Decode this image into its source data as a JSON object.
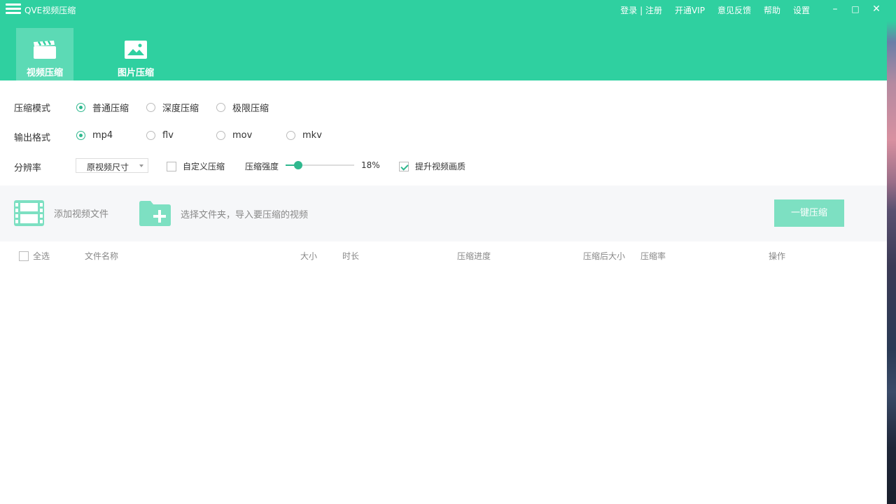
{
  "app": {
    "title": "QVE视频压缩"
  },
  "top_links": [
    "登录 | 注册",
    "开通VIP",
    "意见反馈",
    "帮助",
    "设置"
  ],
  "window_controls": {
    "minimize": "–",
    "maximize": "□",
    "close": "✕"
  },
  "tabs": [
    {
      "label": "视频压缩",
      "icon": "video-clapper-icon",
      "active": true
    },
    {
      "label": "图片压缩",
      "icon": "image-icon",
      "active": false
    }
  ],
  "options": {
    "mode": {
      "label": "压缩模式",
      "choices": [
        "普通压缩",
        "深度压缩",
        "极限压缩"
      ],
      "selected": "普通压缩"
    },
    "format": {
      "label": "输出格式",
      "choices": [
        "mp4",
        "flv",
        "mov",
        "mkv"
      ],
      "selected": "mp4"
    },
    "resolution": {
      "label": "分辨率",
      "selected": "原视频尺寸"
    },
    "custom": {
      "label": "自定义压缩",
      "checked": false
    },
    "strength": {
      "label": "压缩强度",
      "value": "18%",
      "fraction": 0.18
    },
    "enhance": {
      "label": "提升视频画质",
      "checked": true
    }
  },
  "toolbar": {
    "add_file": "添加视频文件",
    "add_folder": "选择文件夹，导入要压缩的视频",
    "compress": "一键压缩"
  },
  "table": {
    "select_all": "全选",
    "columns": [
      "文件名称",
      "大小",
      "时长",
      "压缩进度",
      "压缩后大小",
      "压缩率",
      "操作"
    ]
  },
  "colors": {
    "accent": "#2fd0a0",
    "accent_dark": "#2fb88e",
    "button_disabled": "#7de0c2"
  }
}
